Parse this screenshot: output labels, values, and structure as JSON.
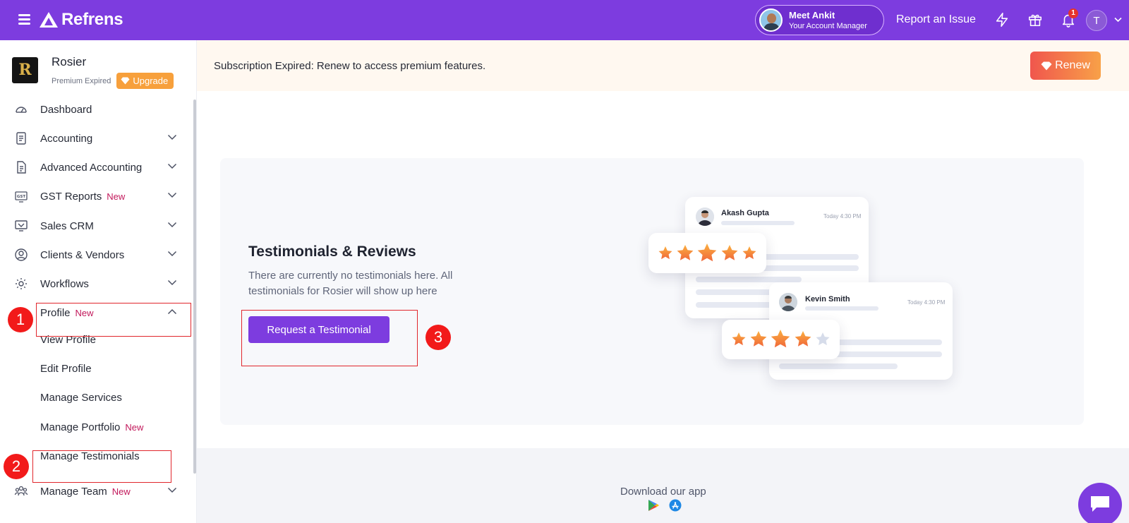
{
  "brand": {
    "name": "Refrens"
  },
  "topbar": {
    "manager_name": "Meet Ankit",
    "manager_role": "Your Account Manager",
    "report_issue": "Report an Issue",
    "notification_count": "1",
    "user_initial": "T"
  },
  "org": {
    "logo_letter": "R",
    "name": "Rosier",
    "status": "Premium Expired",
    "upgrade_label": "Upgrade"
  },
  "sidebar": {
    "items": [
      {
        "label": "Dashboard",
        "icon": "dashboard-icon"
      },
      {
        "label": "Accounting",
        "icon": "accounting-icon"
      },
      {
        "label": "Advanced Accounting",
        "icon": "document-icon"
      },
      {
        "label": "GST Reports",
        "badge": "New",
        "icon": "gst-icon"
      },
      {
        "label": "Sales CRM",
        "icon": "crm-icon"
      },
      {
        "label": "Clients & Vendors",
        "icon": "user-circle-icon"
      },
      {
        "label": "Workflows",
        "icon": "gear-icon"
      },
      {
        "label": "Profile",
        "badge": "New",
        "icon": "none"
      }
    ],
    "profile_subitems": [
      {
        "label": "View Profile"
      },
      {
        "label": "Edit Profile"
      },
      {
        "label": "Manage Services"
      },
      {
        "label": "Manage Portfolio",
        "badge": "New"
      },
      {
        "label": "Manage Testimonials"
      }
    ],
    "team_item": {
      "label": "Manage Team",
      "badge": "New",
      "icon": "team-icon"
    }
  },
  "annotations": {
    "one": "1",
    "two": "2",
    "three": "3"
  },
  "banner": {
    "text": "Subscription Expired: Renew to access premium features.",
    "renew_label": "Renew"
  },
  "empty_state": {
    "title": "Testimonials & Reviews",
    "description": "There are currently no testimonials here. All testimonials for Rosier will show up here",
    "button_label": "Request a Testimonial"
  },
  "illustration": {
    "review_one": {
      "name": "Akash Gupta",
      "time": "Today 4:30 PM",
      "stars": 5
    },
    "review_two": {
      "name": "Kevin Smith",
      "time": "Today 4:30 PM",
      "stars": 4
    }
  },
  "footer": {
    "download_text": "Download our app"
  },
  "colors": {
    "brand": "#7d3cdf",
    "annotation": "#f21a1a",
    "badge_new": "#c2185b",
    "upgrade": "#f7a03c"
  }
}
